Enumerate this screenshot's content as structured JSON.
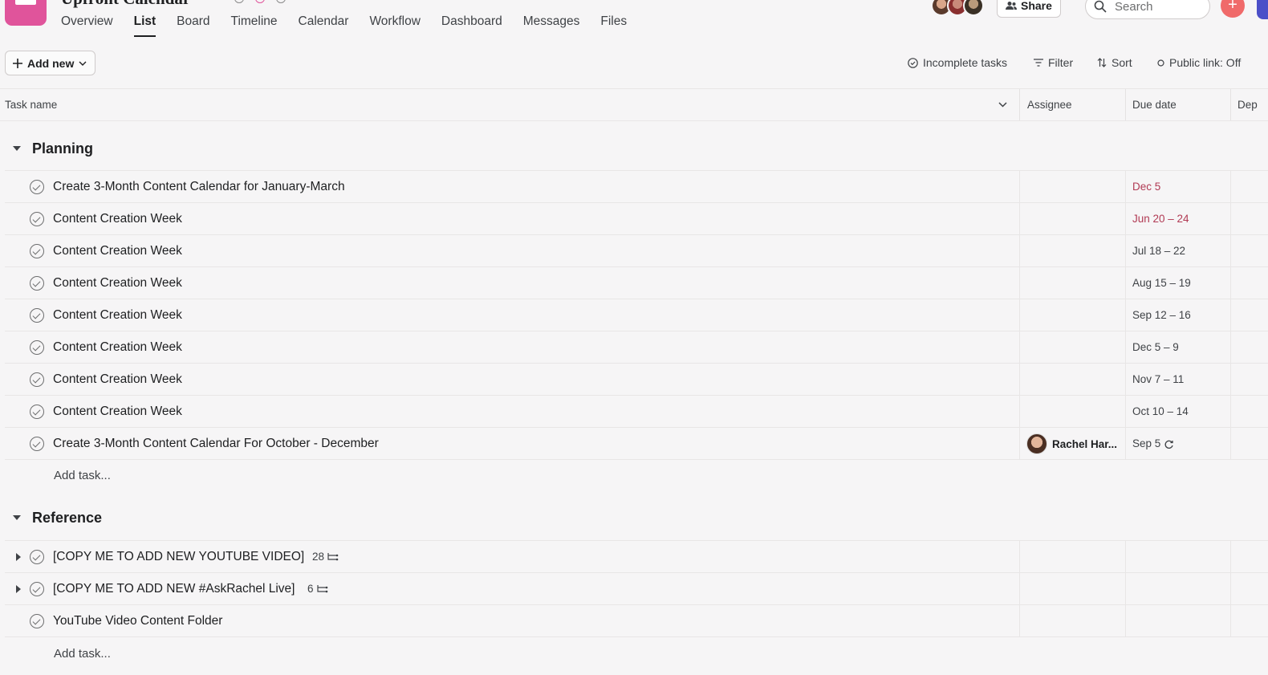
{
  "header": {
    "project_title": "Upfront Calendar",
    "tabs": [
      {
        "label": "Overview",
        "active": false
      },
      {
        "label": "List",
        "active": true
      },
      {
        "label": "Board",
        "active": false
      },
      {
        "label": "Timeline",
        "active": false
      },
      {
        "label": "Calendar",
        "active": false
      },
      {
        "label": "Workflow",
        "active": false
      },
      {
        "label": "Dashboard",
        "active": false
      },
      {
        "label": "Messages",
        "active": false
      },
      {
        "label": "Files",
        "active": false
      }
    ],
    "share_label": "Share",
    "search_placeholder": "Search",
    "accent_color": "#f06a6a",
    "logo_color": "#e0549b"
  },
  "toolbar": {
    "add_new_label": "Add new",
    "incomplete_label": "Incomplete tasks",
    "filter_label": "Filter",
    "sort_label": "Sort",
    "public_link_label": "Public link: Off"
  },
  "columns": {
    "task_name": "Task name",
    "assignee": "Assignee",
    "due_date": "Due date",
    "dependencies": "Dep"
  },
  "sections": [
    {
      "title": "Planning",
      "tasks": [
        {
          "name": "Create 3-Month Content Calendar for January-March",
          "due": "Dec 5",
          "due_color": "#b13a54",
          "assignee": ""
        },
        {
          "name": "Content Creation Week",
          "due": "Jun 20 – 24",
          "due_color": "#b13a54",
          "assignee": ""
        },
        {
          "name": "Content Creation Week",
          "due": "Jul 18 – 22",
          "due_color": "",
          "assignee": ""
        },
        {
          "name": "Content Creation Week",
          "due": "Aug 15 – 19",
          "due_color": "",
          "assignee": ""
        },
        {
          "name": "Content Creation Week",
          "due": "Sep 12 – 16",
          "due_color": "",
          "assignee": ""
        },
        {
          "name": "Content Creation Week",
          "due": "Dec 5 – 9",
          "due_color": "",
          "assignee": ""
        },
        {
          "name": "Content Creation Week",
          "due": "Nov 7 – 11",
          "due_color": "",
          "assignee": ""
        },
        {
          "name": "Content Creation Week",
          "due": "Oct 10 – 14",
          "due_color": "",
          "assignee": ""
        },
        {
          "name": "Create 3-Month Content Calendar For October - December",
          "due": "Sep 5",
          "due_color": "",
          "assignee": "Rachel Har...",
          "recurring": true
        }
      ],
      "add_task_label": "Add task..."
    },
    {
      "title": "Reference",
      "tasks": [
        {
          "name": "[COPY ME TO ADD NEW YOUTUBE VIDEO]",
          "subtasks": "28",
          "expandable": true
        },
        {
          "name": "[COPY ME TO ADD NEW #AskRachel Live]",
          "subtasks": "6",
          "expandable": true
        },
        {
          "name": "YouTube Video Content Folder",
          "subtasks": "",
          "expandable": false
        }
      ],
      "add_task_label": "Add task..."
    }
  ]
}
